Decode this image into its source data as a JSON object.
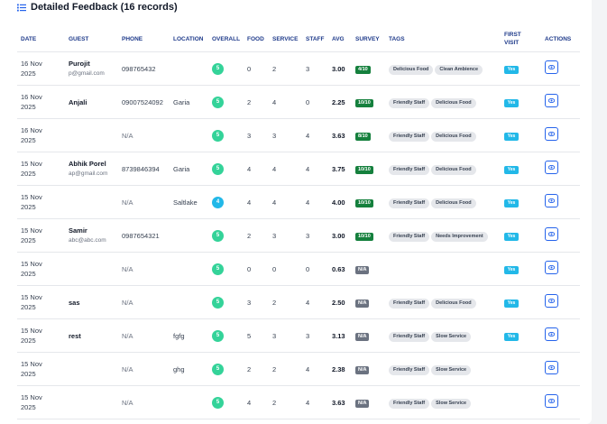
{
  "heading": "Detailed Feedback (16 records)",
  "colors": {
    "accent": "#1e3a8a",
    "green": "#34d399",
    "blue": "#22b8e8",
    "survey_green": "#15803d",
    "survey_na": "#6b7280"
  },
  "columns": {
    "date": "DATE",
    "guest": "GUEST",
    "phone": "PHONE",
    "location": "LOCATION",
    "overall": "OVERALL",
    "food": "FOOD",
    "service": "SERVICE",
    "staff": "STAFF",
    "avg": "AVG",
    "survey": "SURVEY",
    "tags": "TAGS",
    "first_visit_1": "FIRST",
    "first_visit_2": "VISIT",
    "actions": "ACTIONS"
  },
  "rows": [
    {
      "date1": "16 Nov",
      "date2": "2025",
      "name": "Purojit",
      "email": "p@gmail.com",
      "phone": "098765432",
      "location": "",
      "overall": "5",
      "overall_color": "green",
      "food": "0",
      "service": "2",
      "staff": "3",
      "avg": "3.00",
      "survey": "4/10",
      "tags": [
        "Delicious Food",
        "Clean Ambience"
      ],
      "first": "Yes"
    },
    {
      "date1": "16 Nov",
      "date2": "2025",
      "name": "Anjali",
      "email": "",
      "phone": "09007524092",
      "location": "Garia",
      "overall": "5",
      "overall_color": "green",
      "food": "2",
      "service": "4",
      "staff": "0",
      "avg": "2.25",
      "survey": "10/10",
      "tags": [
        "Friendly Staff",
        "Delicious Food"
      ],
      "first": "Yes"
    },
    {
      "date1": "16 Nov",
      "date2": "2025",
      "name": "",
      "email": "",
      "phone": "N/A",
      "location": "",
      "overall": "5",
      "overall_color": "green",
      "food": "3",
      "service": "3",
      "staff": "4",
      "avg": "3.63",
      "survey": "8/10",
      "tags": [
        "Friendly Staff",
        "Delicious Food"
      ],
      "first": "Yes"
    },
    {
      "date1": "15 Nov",
      "date2": "2025",
      "name": "Abhik Porel",
      "email": "ap@gmail.com",
      "phone": "8739846394",
      "location": "Garia",
      "overall": "5",
      "overall_color": "green",
      "food": "4",
      "service": "4",
      "staff": "4",
      "avg": "3.75",
      "survey": "10/10",
      "tags": [
        "Friendly Staff",
        "Delicious Food"
      ],
      "first": "Yes"
    },
    {
      "date1": "15 Nov",
      "date2": "2025",
      "name": "",
      "email": "",
      "phone": "N/A",
      "location": "Saltlake",
      "overall": "4",
      "overall_color": "blue",
      "food": "4",
      "service": "4",
      "staff": "4",
      "avg": "4.00",
      "survey": "10/10",
      "tags": [
        "Friendly Staff",
        "Delicious Food"
      ],
      "first": "Yes"
    },
    {
      "date1": "15 Nov",
      "date2": "2025",
      "name": "Samir",
      "email": "abc@abc.com",
      "phone": "0987654321",
      "location": "",
      "overall": "5",
      "overall_color": "green",
      "food": "2",
      "service": "3",
      "staff": "3",
      "avg": "3.00",
      "survey": "10/10",
      "tags": [
        "Friendly Staff",
        "Needs Improvement"
      ],
      "first": "Yes"
    },
    {
      "date1": "15 Nov",
      "date2": "2025",
      "name": "",
      "email": "",
      "phone": "N/A",
      "location": "",
      "overall": "5",
      "overall_color": "green",
      "food": "0",
      "service": "0",
      "staff": "0",
      "avg": "0.63",
      "survey": "N/A",
      "tags": [],
      "first": "Yes"
    },
    {
      "date1": "15 Nov",
      "date2": "2025",
      "name": "sas",
      "email": "",
      "phone": "N/A",
      "location": "",
      "overall": "5",
      "overall_color": "green",
      "food": "3",
      "service": "2",
      "staff": "4",
      "avg": "2.50",
      "survey": "N/A",
      "tags": [
        "Friendly Staff",
        "Delicious Food"
      ],
      "first": "Yes"
    },
    {
      "date1": "15 Nov",
      "date2": "2025",
      "name": "rest",
      "email": "",
      "phone": "N/A",
      "location": "fgfg",
      "overall": "5",
      "overall_color": "green",
      "food": "5",
      "service": "3",
      "staff": "3",
      "avg": "3.13",
      "survey": "N/A",
      "tags": [
        "Friendly Staff",
        "Slow Service"
      ],
      "first": "Yes"
    },
    {
      "date1": "15 Nov",
      "date2": "2025",
      "name": "",
      "email": "",
      "phone": "N/A",
      "location": "ghg",
      "overall": "5",
      "overall_color": "green",
      "food": "2",
      "service": "2",
      "staff": "4",
      "avg": "2.38",
      "survey": "N/A",
      "tags": [
        "Friendly Staff",
        "Slow Service"
      ],
      "first": ""
    },
    {
      "date1": "15 Nov",
      "date2": "2025",
      "name": "",
      "email": "",
      "phone": "N/A",
      "location": "",
      "overall": "5",
      "overall_color": "green",
      "food": "4",
      "service": "2",
      "staff": "4",
      "avg": "3.63",
      "survey": "N/A",
      "tags": [
        "Friendly Staff",
        "Slow Service"
      ],
      "first": ""
    }
  ]
}
